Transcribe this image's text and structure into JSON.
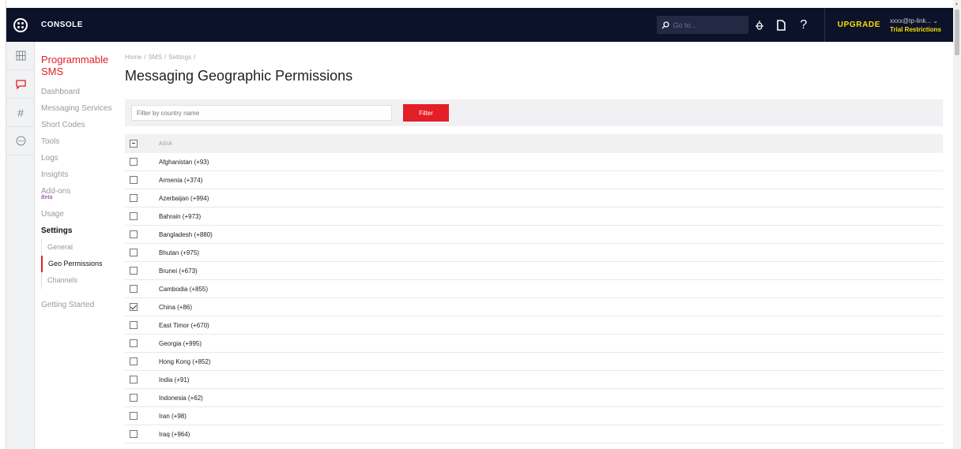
{
  "topbar": {
    "console_label": "CONSOLE",
    "goto_placeholder": "Go to...",
    "upgrade_label": "UPGRADE",
    "account_email": "xxxx@tp-link...",
    "trial_label": "Trial Restrictions",
    "help_icon": "?"
  },
  "sidebar": {
    "product_title_1": "Programmable",
    "product_title_2": "SMS",
    "items": [
      {
        "label": "Dashboard"
      },
      {
        "label": "Messaging Services"
      },
      {
        "label": "Short Codes"
      },
      {
        "label": "Tools"
      },
      {
        "label": "Logs"
      },
      {
        "label": "Insights"
      },
      {
        "label": "Add-ons"
      },
      {
        "label": "Usage"
      },
      {
        "label": "Settings"
      },
      {
        "label": "Getting Started"
      }
    ],
    "beta_label": "Beta",
    "settings_subitems": [
      {
        "label": "General"
      },
      {
        "label": "Geo Permissions"
      },
      {
        "label": "Channels"
      }
    ]
  },
  "breadcrumb": {
    "items": [
      "Home",
      "SMS",
      "Settings"
    ]
  },
  "page_title": "Messaging Geographic Permissions",
  "filter": {
    "placeholder": "Filter by country name",
    "button_label": "Filter"
  },
  "region": {
    "name": "ASIA",
    "countries": [
      {
        "label": "Afghanistan (+93)",
        "checked": false
      },
      {
        "label": "Armenia (+374)",
        "checked": false
      },
      {
        "label": "Azerbaijan (+994)",
        "checked": false
      },
      {
        "label": "Bahrain (+973)",
        "checked": false
      },
      {
        "label": "Bangladesh (+880)",
        "checked": false
      },
      {
        "label": "Bhutan (+975)",
        "checked": false
      },
      {
        "label": "Brunei (+673)",
        "checked": false
      },
      {
        "label": "Cambodia (+855)",
        "checked": false
      },
      {
        "label": "China (+86)",
        "checked": true
      },
      {
        "label": "East Timor (+670)",
        "checked": false
      },
      {
        "label": "Georgia (+995)",
        "checked": false
      },
      {
        "label": "Hong Kong (+852)",
        "checked": false
      },
      {
        "label": "India (+91)",
        "checked": false
      },
      {
        "label": "Indonesia (+62)",
        "checked": false
      },
      {
        "label": "Iran (+98)",
        "checked": false
      },
      {
        "label": "Iraq (+964)",
        "checked": false
      }
    ]
  },
  "colors": {
    "brand_red": "#e31e26",
    "topbar_bg": "#0d122b",
    "upgrade_yellow": "#f9e000"
  }
}
